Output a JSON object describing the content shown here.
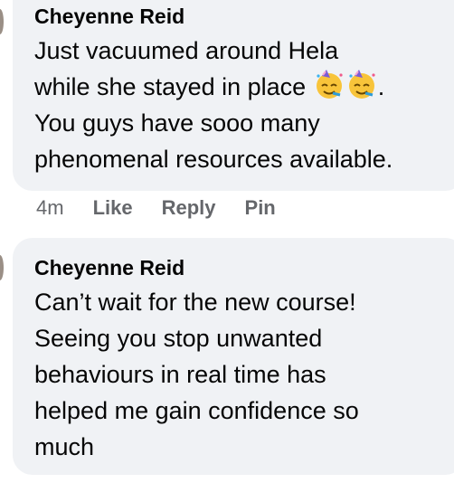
{
  "comments": [
    {
      "author": "Cheyenne Reid",
      "text_before_emoji": "Just vacuumed around Hela\nwhile she stayed in place ",
      "emoji": [
        "partying-face-icon",
        "partying-face-icon"
      ],
      "text_after_emoji": ".\nYou guys have sooo many\nphenomenal resources available.",
      "time": "4m",
      "actions": [
        "Like",
        "Reply",
        "Pin"
      ]
    },
    {
      "author": "Cheyenne Reid",
      "text": "Can’t wait for the new course!\nSeeing you stop unwanted\nbehaviours in real time has\nhelped me gain confidence so\nmuch"
    }
  ],
  "colors": {
    "bubble": "#f0f2f5",
    "text": "#050505",
    "meta": "#65676b"
  }
}
